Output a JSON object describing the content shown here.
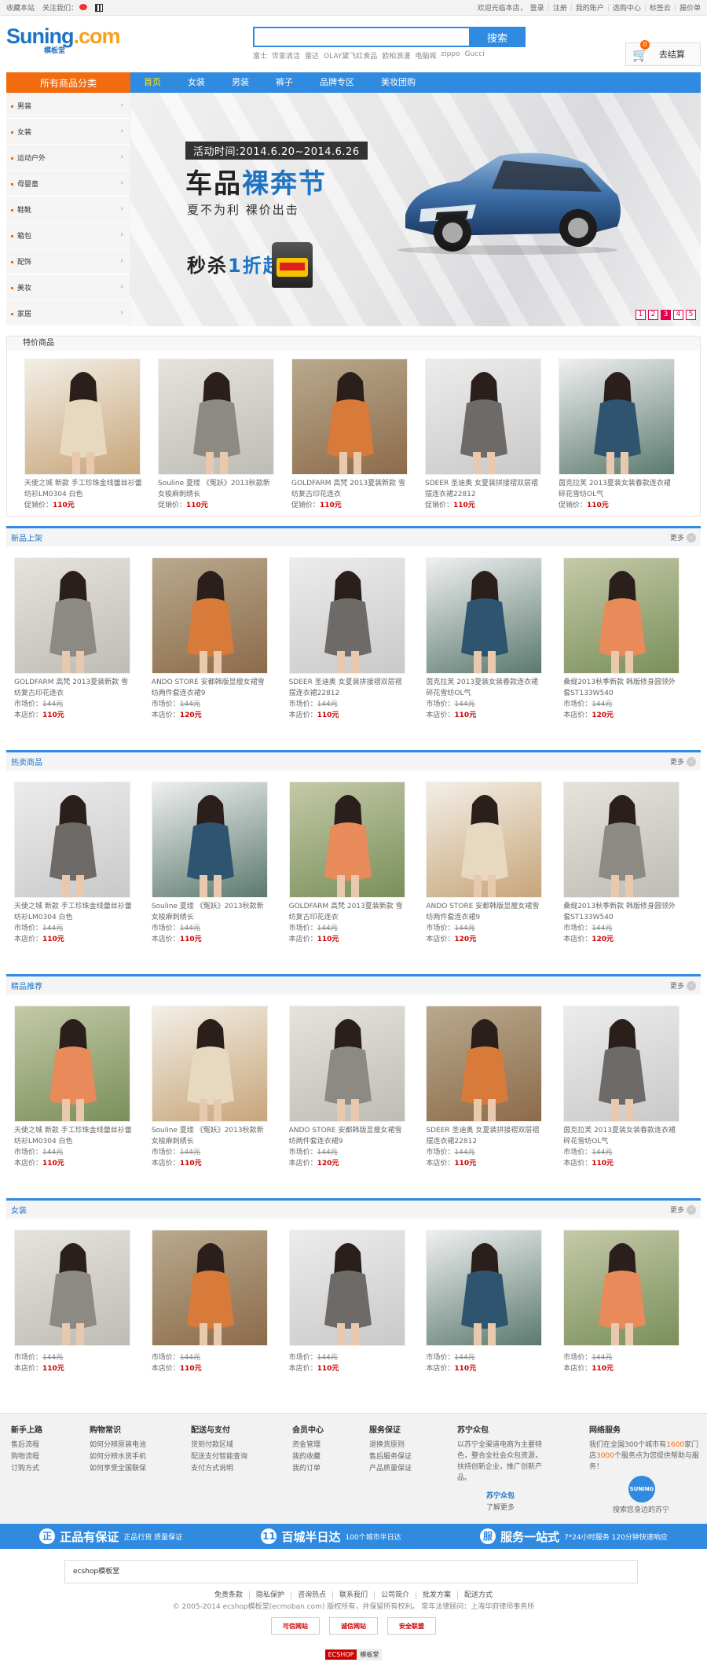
{
  "topbar": {
    "favorite": "收藏本站",
    "follow": "关注我们：",
    "welcome": "欢迎光临本店，",
    "login": "登录",
    "register": "注册",
    "account": "我的账户",
    "track": "选购中心",
    "tags": "标签云",
    "quote": "报价单"
  },
  "logo": {
    "brand_blue": "Suning",
    "brand_orange": ".com",
    "sub": "模板堂"
  },
  "search": {
    "value": "",
    "button": "搜索",
    "hotwords": [
      "富士",
      "世家清洁",
      "雷达",
      "OLAY黛飞红食品",
      "欧柏浪漫",
      "电脑城",
      "zippo",
      "Gucci"
    ]
  },
  "cart": {
    "count": "0",
    "label": "去结算"
  },
  "nav": {
    "all": "所有商品分类",
    "items": [
      "首页",
      "女装",
      "男装",
      "裤子",
      "品牌专区",
      "美妆团购"
    ]
  },
  "categories": [
    "男装",
    "女装",
    "运动户外",
    "母婴童",
    "鞋靴",
    "箱包",
    "配饰",
    "美妆",
    "家居"
  ],
  "banner": {
    "date": "活动时间:2014.6.20~2014.6.26",
    "title_a": "车品",
    "title_b": "裸奔节",
    "sub": "夏不为利 裸价出击",
    "sale_a": "秒杀",
    "sale_b": "1折起",
    "dots": [
      "1",
      "2",
      "3",
      "4",
      "5"
    ]
  },
  "special": {
    "title": "特价商品",
    "products": [
      {
        "name": "天使之城 新款 手工珍珠金线蕾丝衫蕾纺衫LM0304 白色",
        "price_label": "促销价：",
        "price": "110元"
      },
      {
        "name": "Souline 夏缕 《冤妖》2013秋款新女梭麻刺绣长",
        "price_label": "促销价：",
        "price": "110元"
      },
      {
        "name": "GOLDFARM 高梵 2013夏装新款 雪纺复古印花连衣",
        "price_label": "促销价：",
        "price": "110元"
      },
      {
        "name": "SDEER 圣迪奥 女夏装拼接褶双层褶摆连衣裙22812",
        "price_label": "促销价：",
        "price": "110元"
      },
      {
        "name": "茵克拉芙 2013夏装女装春款连衣裙碎花雪纺OL气",
        "price_label": "促销价：",
        "price": "110元"
      }
    ]
  },
  "sections": [
    {
      "title": "新品上架",
      "more": "更多",
      "products": [
        {
          "name": "GOLDFARM 高梵 2013夏装新款 雪纺复古印花连衣",
          "market_label": "市场价：",
          "market": "144元",
          "shop_label": "本店价：",
          "shop": "110元"
        },
        {
          "name": "ANDO STORE 安都韩版显瘦女裙雪纺两件套连衣裙9",
          "market_label": "市场价：",
          "market": "144元",
          "shop_label": "本店价：",
          "shop": "120元"
        },
        {
          "name": "SDEER 圣迪奥 女夏装拼接褶双层褶摆连衣裙22812",
          "market_label": "市场价：",
          "market": "144元",
          "shop_label": "本店价：",
          "shop": "110元"
        },
        {
          "name": "茵克拉芙 2013夏装女装春款连衣裙碎花雪纺OL气",
          "market_label": "市场价：",
          "market": "144元",
          "shop_label": "本店价：",
          "shop": "110元"
        },
        {
          "name": "桑缇2013秋季新款 韩版修身圆领外套ST133W540",
          "market_label": "市场价：",
          "market": "144元",
          "shop_label": "本店价：",
          "shop": "120元"
        }
      ]
    },
    {
      "title": "热卖商品",
      "more": "更多",
      "products": [
        {
          "name": "天使之城 新款 手工珍珠金线蕾丝衫蕾纺衫LM0304 白色",
          "market_label": "市场价：",
          "market": "144元",
          "shop_label": "本店价：",
          "shop": "110元"
        },
        {
          "name": "Souline 夏缕 《冤妖》2013秋款新女梭麻刺绣长",
          "market_label": "市场价：",
          "market": "144元",
          "shop_label": "本店价：",
          "shop": "110元"
        },
        {
          "name": "GOLDFARM 高梵 2013夏装新款 雪纺复古印花连衣",
          "market_label": "市场价：",
          "market": "144元",
          "shop_label": "本店价：",
          "shop": "110元"
        },
        {
          "name": "ANDO STORE 安都韩版显瘦女裙雪纺两件套连衣裙9",
          "market_label": "市场价：",
          "market": "144元",
          "shop_label": "本店价：",
          "shop": "120元"
        },
        {
          "name": "桑缇2013秋季新款 韩版修身圆领外套ST133W540",
          "market_label": "市场价：",
          "market": "144元",
          "shop_label": "本店价：",
          "shop": "120元"
        }
      ]
    },
    {
      "title": "精品推荐",
      "more": "更多",
      "products": [
        {
          "name": "天使之城 新款 手工珍珠金线蕾丝衫蕾纺衫LM0304 白色",
          "market_label": "市场价：",
          "market": "144元",
          "shop_label": "本店价：",
          "shop": "110元"
        },
        {
          "name": "Souline 夏缕 《冤妖》2013秋款新女梭麻刺绣长",
          "market_label": "市场价：",
          "market": "144元",
          "shop_label": "本店价：",
          "shop": "110元"
        },
        {
          "name": "ANDO STORE 安都韩版显瘦女裙雪纺两件套连衣裙9",
          "market_label": "市场价：",
          "market": "144元",
          "shop_label": "本店价：",
          "shop": "120元"
        },
        {
          "name": "SDEER 圣迪奥 女夏装拼接褶双层褶摆连衣裙22812",
          "market_label": "市场价：",
          "market": "144元",
          "shop_label": "本店价：",
          "shop": "110元"
        },
        {
          "name": "茵克拉芙 2013夏装女装春款连衣裙碎花雪纺OL气",
          "market_label": "市场价：",
          "market": "144元",
          "shop_label": "本店价：",
          "shop": "110元"
        }
      ]
    },
    {
      "title": "女装",
      "more": "更多",
      "products": [
        {
          "name": "",
          "market_label": "市场价：",
          "market": "144元",
          "shop_label": "本店价：",
          "shop": "110元"
        },
        {
          "name": "",
          "market_label": "市场价：",
          "market": "144元",
          "shop_label": "本店价：",
          "shop": "110元"
        },
        {
          "name": "",
          "market_label": "市场价：",
          "market": "144元",
          "shop_label": "本店价：",
          "shop": "110元"
        },
        {
          "name": "",
          "market_label": "市场价：",
          "market": "144元",
          "shop_label": "本店价：",
          "shop": "110元"
        },
        {
          "name": "",
          "market_label": "市场价：",
          "market": "144元",
          "shop_label": "本店价：",
          "shop": "110元"
        }
      ]
    }
  ],
  "footer": {
    "cols": [
      {
        "title": "新手上路",
        "items": [
          "售后流程",
          "购物流程",
          "订购方式"
        ]
      },
      {
        "title": "购物常识",
        "items": [
          "如何分辨原装电池",
          "如何分辨水货手机",
          "如何享受全国联保"
        ]
      },
      {
        "title": "配送与支付",
        "items": [
          "货到付款区域",
          "配送支付智能查询",
          "支付方式说明"
        ]
      },
      {
        "title": "会员中心",
        "items": [
          "资金管理",
          "我的收藏",
          "我的订单"
        ]
      },
      {
        "title": "服务保证",
        "items": [
          "退换货原则",
          "售后服务保证",
          "产品质量保证"
        ]
      }
    ],
    "suning": {
      "title": "苏宁众包",
      "text": "以苏宁全渠道电商为主要特色，整合全社会众包资源，扶持创新企业，推广创新产品。",
      "logo": "苏宁众包",
      "more": "了解更多"
    },
    "network": {
      "title": "网络服务",
      "text_a": "我们在全国300个城市有",
      "num_a": "1600",
      "text_b": "家门店",
      "num_b": "3000",
      "text_c": "个服务点为您提供帮助与服务！",
      "logo": "SUNING",
      "search": "搜索您身边的苏宁"
    },
    "strip": [
      {
        "icon": "正",
        "big": "正品有保证",
        "sm": "正品行货  质量保证"
      },
      {
        "icon": "11",
        "big": "百城半日达",
        "sm": "100个城市半日达"
      },
      {
        "icon": "服",
        "big": "服务一站式",
        "sm": "7*24小时服务 120分钟快速响应"
      }
    ],
    "friend_link": "ecshop模板堂",
    "links": [
      "免责条款",
      "隐私保护",
      "咨询热点",
      "联系我们",
      "公司简介",
      "批发方案",
      "配送方式"
    ],
    "copyright": "© 2005-2014 ecshop模板堂(ecmoban.com) 版权所有，并保留所有权利。   常年法律顾问：上海华府律师事务所",
    "badges": [
      "可信网站",
      "诚信网站",
      "安全联盟"
    ],
    "powered_a": "ECSHOP",
    "powered_b": "模板堂"
  }
}
